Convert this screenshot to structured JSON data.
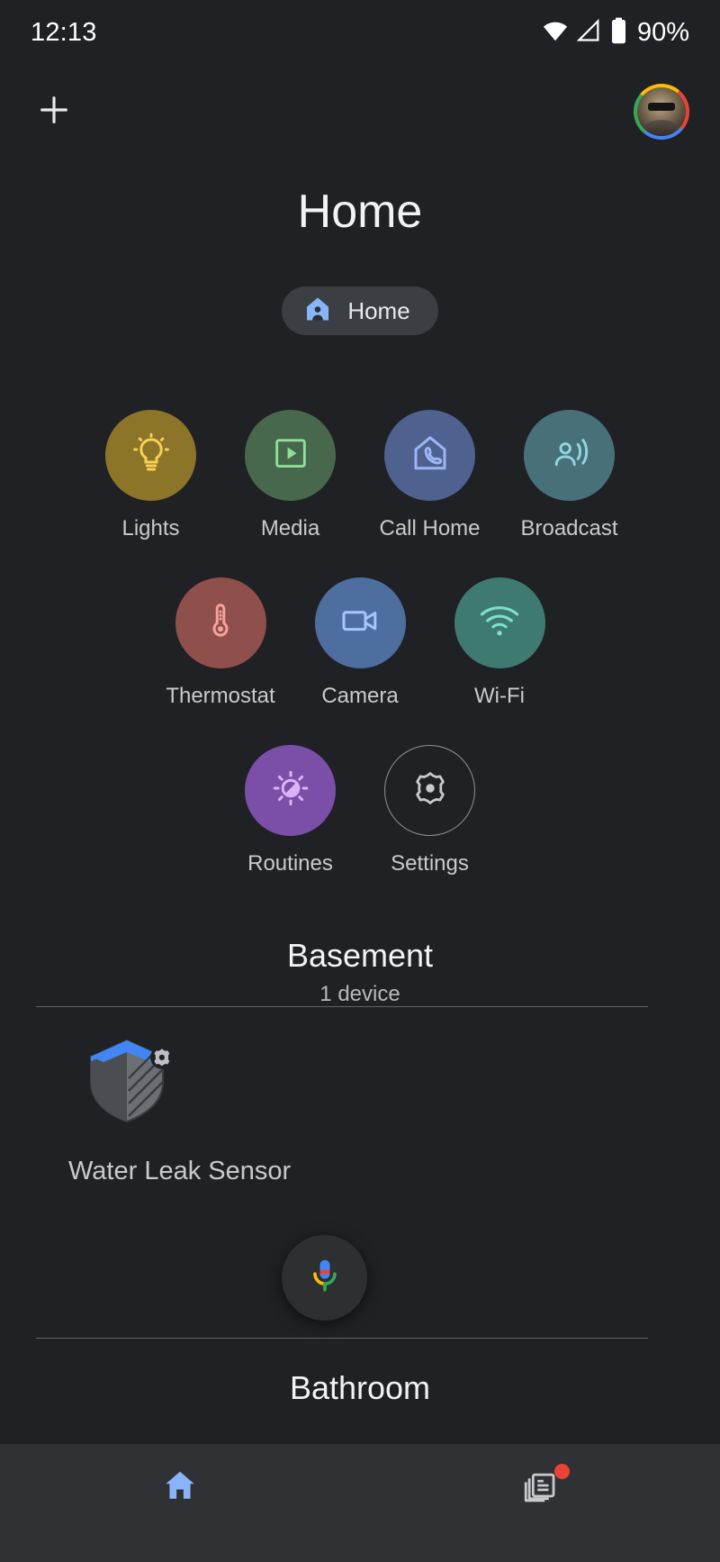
{
  "status_bar": {
    "time": "12:13",
    "battery_percent": "90%",
    "wifi_icon": "wifi-icon",
    "signal_icon": "cell-signal-icon",
    "battery_icon": "battery-icon"
  },
  "app_bar": {
    "add_label": "+",
    "add_icon": "plus-icon",
    "avatar_icon": "account-avatar"
  },
  "header": {
    "title": "Home"
  },
  "home_chip": {
    "label": "Home",
    "icon": "home-person-icon"
  },
  "quick_actions": {
    "rows": [
      [
        {
          "label": "Lights",
          "icon": "lightbulb-icon",
          "bg": "#8c7428",
          "fg": "#f6d155"
        },
        {
          "label": "Media",
          "icon": "play-box-icon",
          "bg": "#47684c",
          "fg": "#8fe09a"
        },
        {
          "label": "Call Home",
          "icon": "home-phone-icon",
          "bg": "#4e618f",
          "fg": "#9cb6f7"
        },
        {
          "label": "Broadcast",
          "icon": "broadcast-icon",
          "bg": "#487079",
          "fg": "#8fd5dd"
        }
      ],
      [
        {
          "label": "Thermostat",
          "icon": "thermometer-icon",
          "bg": "#8f4f4b",
          "fg": "#f6a39c"
        },
        {
          "label": "Camera",
          "icon": "video-camera-icon",
          "bg": "#4e6ea0",
          "fg": "#a8c4fa"
        },
        {
          "label": "Wi-Fi",
          "icon": "wifi-waves-icon",
          "bg": "#3f7a70",
          "fg": "#7fe0cd"
        }
      ],
      [
        {
          "label": "Routines",
          "icon": "routines-sun-icon",
          "bg": "#7b4fa8",
          "fg": "#ddb3f8"
        },
        {
          "label": "Settings",
          "icon": "gear-icon",
          "bg": "transparent",
          "fg": "#c8cace"
        }
      ]
    ]
  },
  "rooms": [
    {
      "name": "Basement",
      "device_count_label": "1 device",
      "devices": [
        {
          "name": "Water Leak Sensor",
          "icon": "water-leak-sensor-icon"
        }
      ]
    }
  ],
  "next_room_peek": {
    "name": "Bathroom"
  },
  "assistant_fab": {
    "icon": "google-assistant-mic-icon"
  },
  "bottom_nav": {
    "items": [
      {
        "label": "Home",
        "icon": "home-icon",
        "active": true,
        "badge": false
      },
      {
        "label": "Feed",
        "icon": "feed-icon",
        "active": false,
        "badge": true
      }
    ]
  },
  "colors": {
    "background": "#202124",
    "nav_background": "#303134",
    "accent_blue": "#8ab4f8",
    "badge_red": "#ea4335",
    "divider": "#5f6368",
    "text_primary": "#f1f3f4",
    "text_secondary": "#c8cace"
  }
}
